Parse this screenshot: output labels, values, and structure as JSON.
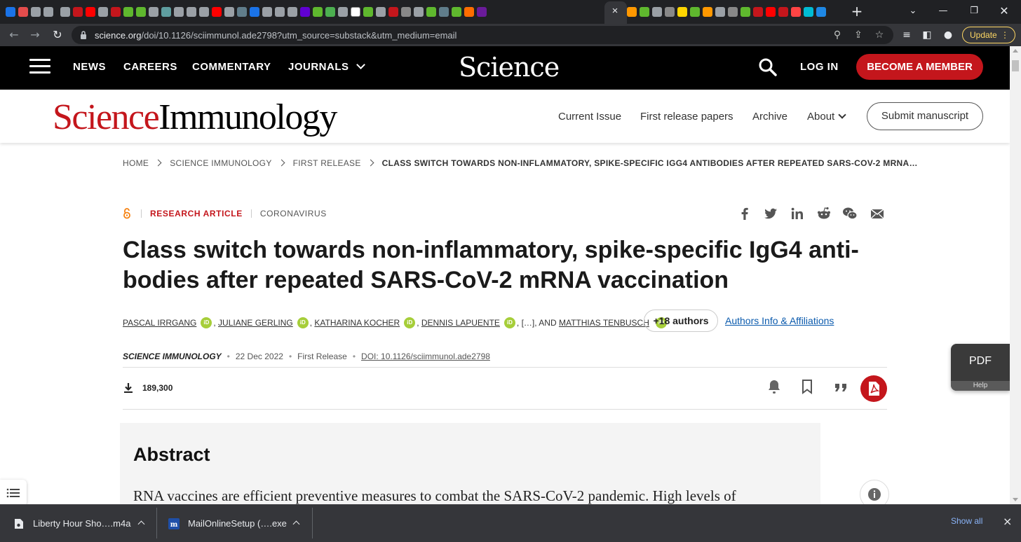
{
  "browser": {
    "url_domain": "science.org",
    "url_path": "/doi/10.1126/sciimmunol.ade2798?utm_source=substack&utm_medium=email",
    "update_label": "Update",
    "update_dots": "⋮",
    "tab_close": "×",
    "new_tab": "+",
    "tab_icons": [
      "#1a73e8",
      "#e34c4c",
      "#9aa0a6",
      "#9aa0a6",
      "#9aa0a6",
      "#c4161c",
      "#ff0000",
      "#9aa0a6",
      "#c4161c",
      "#5fb82e",
      "#5fb82e",
      "#9aa0a6",
      "#5f9ea0",
      "#9aa0a6",
      "#9aa0a6",
      "#9aa0a6",
      "#ff0000",
      "#9aa0a6",
      "#607d8b",
      "#1a73e8",
      "#9aa0a6",
      "#9aa0a6",
      "#9aa0a6",
      "#6001d2",
      "#5fb82e",
      "#4caf50",
      "#9aa0a6",
      "#ffffff",
      "#5fb82e",
      "#9aa0a6",
      "#c4161c",
      "#888888",
      "#9aa0a6",
      "#5fb82e",
      "#607d8b",
      "#5fb82e",
      "#ff6d00",
      "#6a1b9a"
    ],
    "tab_icons_right": [
      "#ff9800",
      "#5fb82e",
      "#9aa0a6",
      "#888888",
      "#ffd600",
      "#5fb82e",
      "#ff9800",
      "#9aa0a6",
      "#888888",
      "#5fb82e",
      "#c4161c",
      "#ff0000",
      "#c4161c",
      "#ff4444",
      "#00bcd4",
      "#1e88e5"
    ]
  },
  "site": {
    "nav_links": [
      "NEWS",
      "CAREERS",
      "COMMENTARY",
      "JOURNALS"
    ],
    "logo": "Science",
    "login": "LOG IN",
    "member": "BECOME A MEMBER"
  },
  "journal": {
    "logo_part1": "Science",
    "logo_part2": "Immunology",
    "links": [
      "Current Issue",
      "First release papers",
      "Archive",
      "About"
    ],
    "submit": "Submit manuscript"
  },
  "breadcrumb": [
    "HOME",
    "SCIENCE IMMUNOLOGY",
    "FIRST RELEASE",
    "CLASS SWITCH TOWARDS NON-INFLAMMATORY, SPIKE-SPECIFIC IGG4 ANTIBODIES AFTER REPEATED SARS-COV-2 MRNA…"
  ],
  "article": {
    "type": "RESEARCH ARTICLE",
    "topic": "CORONAVIRUS",
    "title_line1": "Class switch towards non-inflammatory, spike-specific IgG4 anti-",
    "title_line2": "bodies after repeated SARS-CoV-2 mRNA vaccination",
    "authors": [
      "PASCAL IRRGANG",
      "JULIANE GERLING",
      "KATHARINA KOCHER",
      "DENNIS LAPUENTE"
    ],
    "orcid_label": "iD",
    "ellipsis": "[…], AND",
    "last_author": "MATTHIAS TENBUSCH",
    "more_authors": "+18 authors",
    "affiliations_link": "Authors Info & Affiliations",
    "journal_name": "SCIENCE IMMUNOLOGY",
    "date": "22 Dec 2022",
    "release": "First Release",
    "doi": "DOI: 10.1126/sciimmunol.ade2798",
    "downloads": "189,300",
    "abstract_heading": "Abstract",
    "abstract_text": "RNA vaccines are efficient preventive measures to combat the SARS-CoV-2 pandemic. High levels of"
  },
  "pdf_widget": {
    "label": "PDF",
    "help": "Help"
  },
  "downloads_shelf": {
    "items": [
      "Liberty Hour Sho….m4a",
      "MailOnlineSetup (….exe"
    ],
    "show_all": "Show all",
    "close": "×"
  }
}
